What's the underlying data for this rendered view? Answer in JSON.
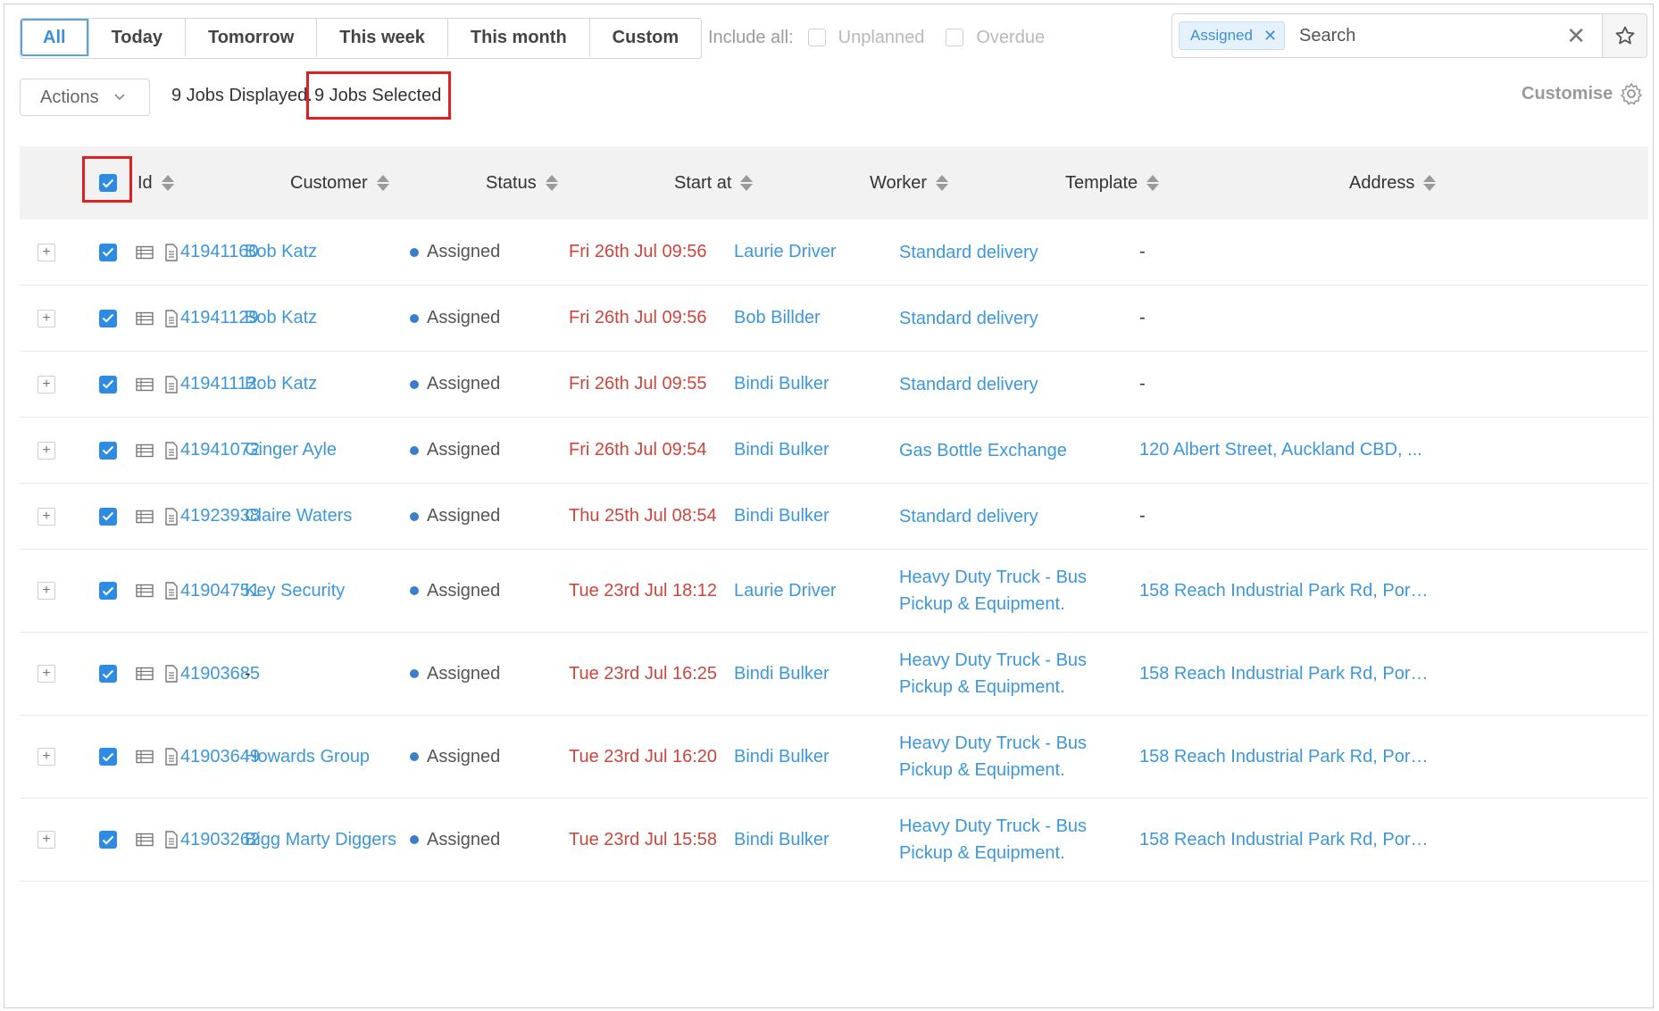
{
  "filters": {
    "tabs": [
      {
        "label": "All",
        "active": true
      },
      {
        "label": "Today",
        "active": false
      },
      {
        "label": "Tomorrow",
        "active": false
      },
      {
        "label": "This week",
        "active": false
      },
      {
        "label": "This month",
        "active": false
      },
      {
        "label": "Custom",
        "active": false
      }
    ],
    "include_all_label": "Include all:",
    "include_options": [
      "Unplanned",
      "Overdue"
    ]
  },
  "search": {
    "tag": "Assigned",
    "placeholder": "Search"
  },
  "toolbar": {
    "actions_label": "Actions",
    "jobs_displayed": "9 Jobs Displayed.",
    "jobs_selected": "9 Jobs Selected",
    "customise_label": "Customise"
  },
  "table": {
    "headers": {
      "id": "Id",
      "customer": "Customer",
      "status": "Status",
      "start_at": "Start at",
      "worker": "Worker",
      "template": "Template",
      "address": "Address"
    },
    "rows": [
      {
        "id": "41941160",
        "customer": "Bob Katz",
        "status": "Assigned",
        "start_at": "Fri 26th Jul 09:56",
        "worker": "Laurie Driver",
        "template": "Standard delivery",
        "address": "-"
      },
      {
        "id": "41941129",
        "customer": "Bob Katz",
        "status": "Assigned",
        "start_at": "Fri 26th Jul 09:56",
        "worker": "Bob Billder",
        "template": "Standard delivery",
        "address": "-"
      },
      {
        "id": "41941112",
        "customer": "Bob Katz",
        "status": "Assigned",
        "start_at": "Fri 26th Jul 09:55",
        "worker": "Bindi Bulker",
        "template": "Standard delivery",
        "address": "-"
      },
      {
        "id": "41941072",
        "customer": "Ginger Ayle",
        "status": "Assigned",
        "start_at": "Fri 26th Jul 09:54",
        "worker": "Bindi Bulker",
        "template": "Gas Bottle Exchange",
        "address": "120 Albert Street, Auckland CBD, ..."
      },
      {
        "id": "41923938",
        "customer": "Claire Waters",
        "status": "Assigned",
        "start_at": "Thu 25th Jul 08:54",
        "worker": "Bindi Bulker",
        "template": "Standard delivery",
        "address": "-"
      },
      {
        "id": "41904751",
        "customer": "Key Security",
        "status": "Assigned",
        "start_at": "Tue 23rd Jul 18:12",
        "worker": "Laurie Driver",
        "template": "Heavy Duty Truck - Bus Pickup & Equipment.",
        "address": "158 Reach Industrial Park Rd, Port..."
      },
      {
        "id": "41903685",
        "customer": "-",
        "status": "Assigned",
        "start_at": "Tue 23rd Jul 16:25",
        "worker": "Bindi Bulker",
        "template": "Heavy Duty Truck - Bus Pickup & Equipment.",
        "address": "158 Reach Industrial Park Rd, Port..."
      },
      {
        "id": "41903649",
        "customer": "Howards Group",
        "status": "Assigned",
        "start_at": "Tue 23rd Jul 16:20",
        "worker": "Bindi Bulker",
        "template": "Heavy Duty Truck - Bus Pickup & Equipment.",
        "address": "158 Reach Industrial Park Rd, Port..."
      },
      {
        "id": "41903262",
        "customer": "Bigg Marty Diggers",
        "status": "Assigned",
        "start_at": "Tue 23rd Jul 15:58",
        "worker": "Bindi Bulker",
        "template": "Heavy Duty Truck - Bus Pickup & Equipment.",
        "address": "158 Reach Industrial Park Rd, Port..."
      }
    ]
  },
  "colors": {
    "link": "#3d97d8",
    "date": "#c9473d",
    "checkbox": "#2e8be3",
    "highlight": "#e02020"
  }
}
